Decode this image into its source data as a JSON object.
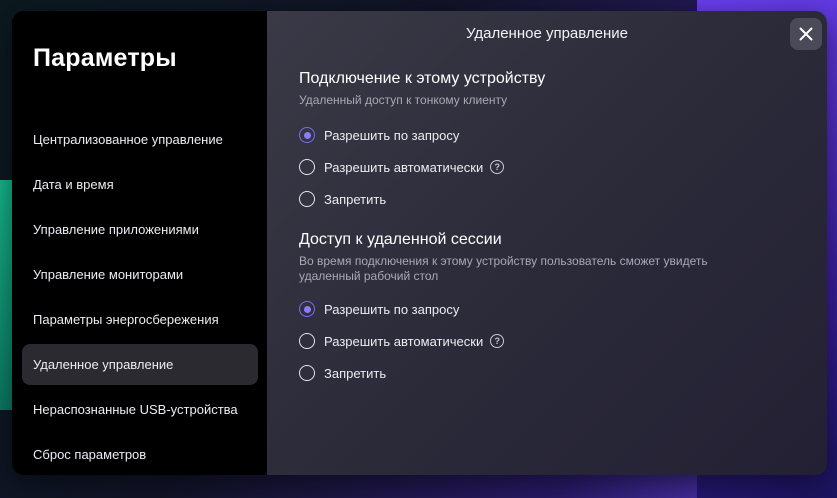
{
  "sidebar": {
    "title": "Параметры",
    "items": [
      {
        "label": "Централизованное управление"
      },
      {
        "label": "Дата и время"
      },
      {
        "label": "Управление приложениями"
      },
      {
        "label": "Управление мониторами"
      },
      {
        "label": "Параметры энергосбережения"
      },
      {
        "label": "Удаленное управление"
      },
      {
        "label": "Нераспознанные USB-устройства"
      },
      {
        "label": "Сброс параметров"
      }
    ],
    "active_index": 5
  },
  "content": {
    "title": "Удаленное управление",
    "sections": [
      {
        "title": "Подключение к этому устройству",
        "subtitle": "Удаленный доступ к тонкому клиенту",
        "options": [
          {
            "label": "Разрешить по запросу",
            "checked": true
          },
          {
            "label": "Разрешить автоматически",
            "checked": false
          },
          {
            "label": "Запретить",
            "checked": false
          }
        ]
      },
      {
        "title": "Доступ к удаленной сессии",
        "subtitle": "Во время подключения к этому устройству пользователь сможет увидеть удаленный рабочий стол",
        "options": [
          {
            "label": "Разрешить по запросу",
            "checked": true
          },
          {
            "label": "Разрешить автоматически",
            "checked": false
          },
          {
            "label": "Запретить",
            "checked": false
          }
        ]
      }
    ],
    "help_glyph": "?"
  },
  "colors": {
    "accent": "#8b7cff",
    "sidebar_bg": "#000000",
    "active_item_bg": "#2a2a30"
  }
}
